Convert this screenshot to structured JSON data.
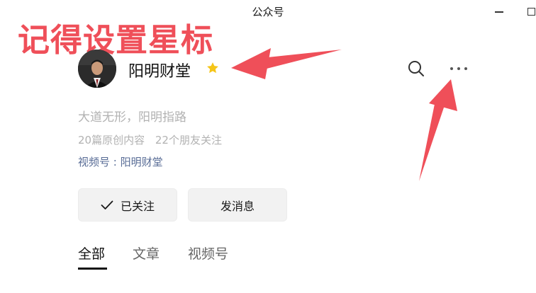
{
  "window": {
    "title": "公众号"
  },
  "annotation": {
    "text": "记得设置星标",
    "color": "#ef4f59"
  },
  "account": {
    "name": "阳明财堂",
    "starred": true,
    "slogan": "大道无形，阳明指路",
    "original_count_text": "20篇原创内容",
    "friends_following_text": "22个朋友关注",
    "channel_text": "视频号 : 阳明财堂"
  },
  "toolbar": {
    "search_icon": "search-icon",
    "more_icon": "more-icon"
  },
  "buttons": {
    "follow_label": "已关注",
    "message_label": "发消息"
  },
  "tabs": [
    {
      "label": "全部",
      "active": true
    },
    {
      "label": "文章",
      "active": false
    },
    {
      "label": "视频号",
      "active": false
    }
  ],
  "colors": {
    "link": "#576b95",
    "muted": "#b2b2b2",
    "star": "#f5c518",
    "arrow": "#ef4f59"
  }
}
